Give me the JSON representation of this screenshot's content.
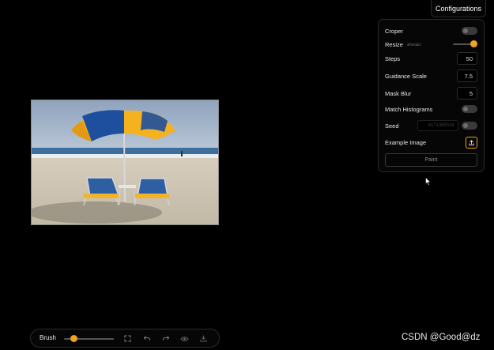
{
  "config_tab": {
    "label": "Configurations"
  },
  "panel": {
    "croper": {
      "label": "Croper"
    },
    "resize": {
      "label": "Resize",
      "dims": "474×317"
    },
    "steps": {
      "label": "Steps",
      "value": "50"
    },
    "guidance_scale": {
      "label": "Guidance Scale",
      "value": "7.5"
    },
    "mask_blur": {
      "label": "Mask Blur",
      "value": "5"
    },
    "match_histograms": {
      "label": "Match Histograms"
    },
    "seed": {
      "label": "Seed",
      "value": "4171385534"
    },
    "example_image": {
      "label": "Example Image",
      "icon": "upload-icon"
    },
    "paint_button": {
      "label": "Paint"
    }
  },
  "toolbar": {
    "tool_label": "Brush",
    "icons": [
      "fullscreen-icon",
      "undo-icon",
      "redo-icon",
      "eye-icon",
      "download-icon"
    ]
  },
  "watermark": {
    "text": "CSDN @Good@dz"
  },
  "colors": {
    "accent": "#f0a31f",
    "background": "#000000",
    "panel_border": "#2a2a2a",
    "toggle_off": "#3a3a3a"
  }
}
